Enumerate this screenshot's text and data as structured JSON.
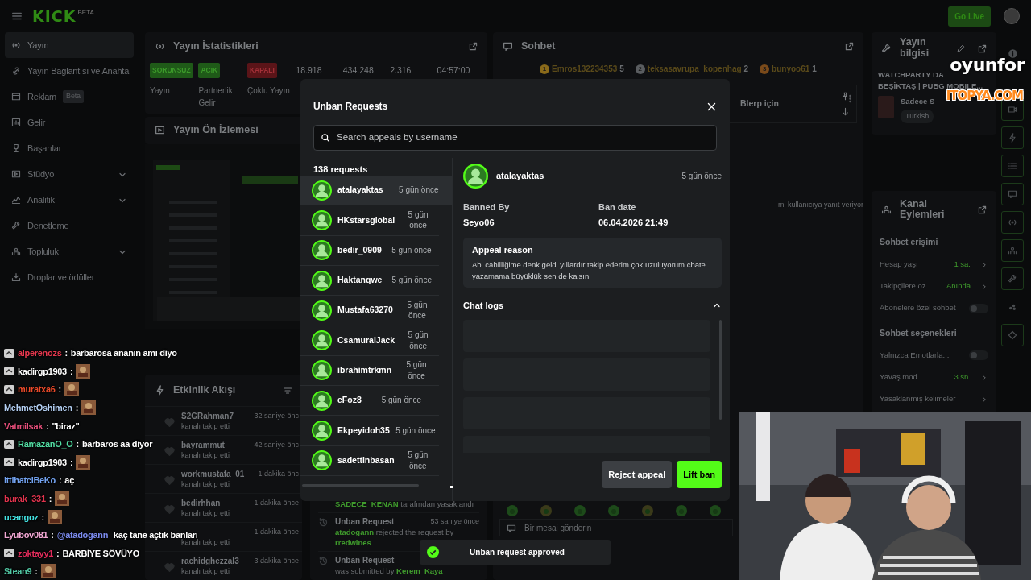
{
  "topbar": {
    "logo": "KICK",
    "logo_tag": "BETA",
    "go_live": "Go Live"
  },
  "sidebar": [
    {
      "label": "Yayın",
      "selected": true
    },
    {
      "label": "Yayın Bağlantısı ve Anahta",
      "selected": false
    },
    {
      "label": "Reklam",
      "badge": "Beta",
      "selected": false
    },
    {
      "label": "Gelir",
      "selected": false
    },
    {
      "label": "Başarılar",
      "selected": false
    },
    {
      "label": "Stüdyo",
      "expandable": true,
      "selected": false
    },
    {
      "label": "Analitik",
      "expandable": true,
      "selected": false
    },
    {
      "label": "Denetleme",
      "selected": false
    },
    {
      "label": "Topluluk",
      "expandable": true,
      "selected": false
    },
    {
      "label": "Droplar ve ödüller",
      "selected": false
    }
  ],
  "stats": {
    "title": "Yayın İstatistikleri",
    "statuses": [
      {
        "badge": "SORUNSUZ",
        "active": true,
        "label": "Yayın"
      },
      {
        "badge": "ACIK",
        "active": true,
        "label": "Partnerlik Gelir"
      },
      {
        "badge": "KAPALI",
        "active": false,
        "label": "Çoklu Yayın"
      }
    ],
    "numbers": [
      "18.918",
      "434.248",
      "2.316",
      "04:57:00"
    ]
  },
  "preview": {
    "title": "Yayın Ön İzlemesi"
  },
  "activity": {
    "title": "Etkinlik Akışı",
    "items": [
      {
        "user": "S2GRahman7",
        "time": "32 saniye önc",
        "action": "kanalı takip etti"
      },
      {
        "user": "bayrammut",
        "time": "42 saniye önc",
        "action": "kanalı takip etti"
      },
      {
        "user": "workmustafa_01",
        "time": "1 dakika önc",
        "action": "kanalı takip etti"
      },
      {
        "user": "bedirhhan",
        "time": "1 dakika önce",
        "action": "kanalı takip etti"
      },
      {
        "time": "1 dakika önce",
        "action": "kanalı takip etti"
      },
      {
        "user": "rachidghezzal3",
        "time": "3 dakika önce",
        "action": "kanalı takip etti"
      }
    ]
  },
  "modlog": [
    {
      "parts": [
        {
          "kind": "user",
          "text": "SADECE_KENAN"
        },
        {
          "kind": "plain",
          "text": " tarafından yasaklandı"
        }
      ]
    },
    {
      "title": "Unban Request",
      "time": "53 saniye önce",
      "parts": [
        {
          "kind": "user",
          "text": "atadogann"
        },
        {
          "kind": "plain",
          "text": " rejected the request by "
        },
        {
          "kind": "user",
          "text": "rredwines"
        }
      ]
    },
    {
      "title": "Unban Request",
      "parts": [
        {
          "kind": "plain",
          "text": "was submitted by "
        },
        {
          "kind": "user",
          "text": "Kerem_Kaya"
        }
      ]
    }
  ],
  "chat": {
    "title": "Sohbet",
    "gifters": [
      {
        "rank": "1",
        "name": "Emros132234353",
        "count": "5",
        "color": "#8a6a1a"
      },
      {
        "rank": "2",
        "name": "teksasavrupa_kopenhag",
        "count": "2",
        "color": "#5a5d60"
      },
      {
        "rank": "3",
        "name": "bunyoo61",
        "count": "1",
        "color": "#7a4a1a"
      }
    ],
    "pinned": "Blerp için",
    "reply_note": "mi kullanıcıya yanıt veriyor",
    "input_placeholder": "Bir mesaj gönderin"
  },
  "info": {
    "title": "Yayın bilgisi",
    "stream_title": "WATCHPARTY DA",
    "stream_subtitle": "BEŞİKTAŞ | PUBG MOBILE...",
    "channel": "Sadece S",
    "language": "Turkish"
  },
  "actions": {
    "title": "Kanal Eylemleri",
    "sections": [
      {
        "title": "Sohbet erişimi",
        "rows": [
          {
            "kind": "link",
            "label": "Hesap yaşı",
            "value": "1 sa."
          },
          {
            "kind": "link",
            "label": "Takipçilere öz...",
            "value": "Anında"
          },
          {
            "kind": "toggle",
            "label": "Abonelere özel sohbet",
            "on": false
          }
        ]
      },
      {
        "title": "Sohbet seçenekleri",
        "rows": [
          {
            "kind": "toggle",
            "label": "Yalnızca Emotlarla...",
            "on": false
          },
          {
            "kind": "link",
            "label": "Yavaş mod",
            "value": "3 sn."
          },
          {
            "kind": "link",
            "label": "Yasaklanmış kelimeler"
          }
        ]
      }
    ]
  },
  "chat_separator": ":",
  "chat_overlay": [
    {
      "user": "alperenozs",
      "color": "#e8384f",
      "badge": true,
      "parts": [
        {
          "kind": "text",
          "text": "barbarosa ananın amı diyo"
        }
      ]
    },
    {
      "user": "kadirgp1903",
      "color": "#ffffff",
      "badge": true,
      "parts": [
        {
          "kind": "emote"
        }
      ]
    },
    {
      "user": "muratxa6",
      "color": "#ea4a2a",
      "badge": true,
      "parts": [
        {
          "kind": "emote"
        }
      ]
    },
    {
      "user": "MehmetOshimen",
      "color": "#b4d0f4",
      "badge": false,
      "parts": [
        {
          "kind": "emote"
        }
      ]
    },
    {
      "user": "Vatmilsak",
      "color": "#e8507c",
      "badge": false,
      "parts": [
        {
          "kind": "text",
          "text": "\"biraz\""
        }
      ]
    },
    {
      "user": "RamazanO_O",
      "color": "#52dca2",
      "badge": true,
      "parts": [
        {
          "kind": "text",
          "text": "barbaros aa diyor"
        }
      ]
    },
    {
      "user": "kadirgp1903",
      "color": "#ffffff",
      "badge": true,
      "parts": [
        {
          "kind": "emote"
        }
      ]
    },
    {
      "user": "ittihatciBeKo",
      "color": "#74a4f2",
      "badge": false,
      "parts": [
        {
          "kind": "text",
          "text": "aç"
        }
      ]
    },
    {
      "user": "burak_331",
      "color": "#e2344e",
      "badge": false,
      "parts": [
        {
          "kind": "emote"
        }
      ]
    },
    {
      "user": "ucangoz",
      "color": "#44e2e2",
      "badge": false,
      "parts": [
        {
          "kind": "emote"
        }
      ]
    },
    {
      "user": "Lyubov081",
      "color": "#f2a8d4",
      "badge": false,
      "parts": [
        {
          "kind": "mention",
          "text": "@atadogann"
        },
        {
          "kind": "text",
          "text": " kaç tane açtık banları"
        }
      ]
    },
    {
      "user": "zoktayy1",
      "color": "#e42c5c",
      "badge": true,
      "parts": [
        {
          "kind": "text",
          "text": "BARBİYE SÖVÜYO"
        }
      ]
    },
    {
      "user": "Stean9",
      "color": "#52c8a4",
      "badge": false,
      "parts": [
        {
          "kind": "emote"
        }
      ]
    }
  ],
  "modal": {
    "title": "Unban Requests",
    "search_placeholder": "Search appeals by username",
    "count": "138 requests",
    "requests": [
      {
        "user": "atalayaktas",
        "time": "5 gün önce",
        "selected": true
      },
      {
        "user": "HKstarsglobal",
        "time": "5 gün önce",
        "selected": false
      },
      {
        "user": "bedir_0909",
        "time": "5 gün önce",
        "selected": false
      },
      {
        "user": "Haktanqwe",
        "time": "5 gün önce",
        "selected": false
      },
      {
        "user": "Mustafa63270",
        "time": "5 gün önce",
        "selected": false
      },
      {
        "user": "CsamuraiJack",
        "time": "5 gün önce",
        "selected": false
      },
      {
        "user": "ibrahimtrkmn",
        "time": "5 gün önce",
        "selected": false
      },
      {
        "user": "eFoz8",
        "time": "5 gün önce",
        "selected": false
      },
      {
        "user": "Ekpeyidoh35",
        "time": "5 gün önce",
        "selected": false
      },
      {
        "user": "sadettinbasan",
        "time": "5 gün önce",
        "selected": false
      }
    ],
    "detail": {
      "user": "atalayaktas",
      "time": "5 gün önce",
      "banned_by_label": "Banned By",
      "banned_by": "Seyo06",
      "ban_date_label": "Ban date",
      "ban_date": "06.04.2026 21:49",
      "appeal_label": "Appeal reason",
      "appeal": "Abi cahilliğime denk geldi yıllardır takip ederim çok üzülüyorum chate yazamama büyüklük sen de kalsın",
      "logs_label": "Chat logs",
      "logs_expanded": true
    },
    "reject": "Reject appeal",
    "lift": "Lift ban"
  },
  "toast": {
    "text": "Unban request approved"
  },
  "sponsor": {
    "top": "oyunfor",
    "bottom": "ITOPYA.COM"
  }
}
